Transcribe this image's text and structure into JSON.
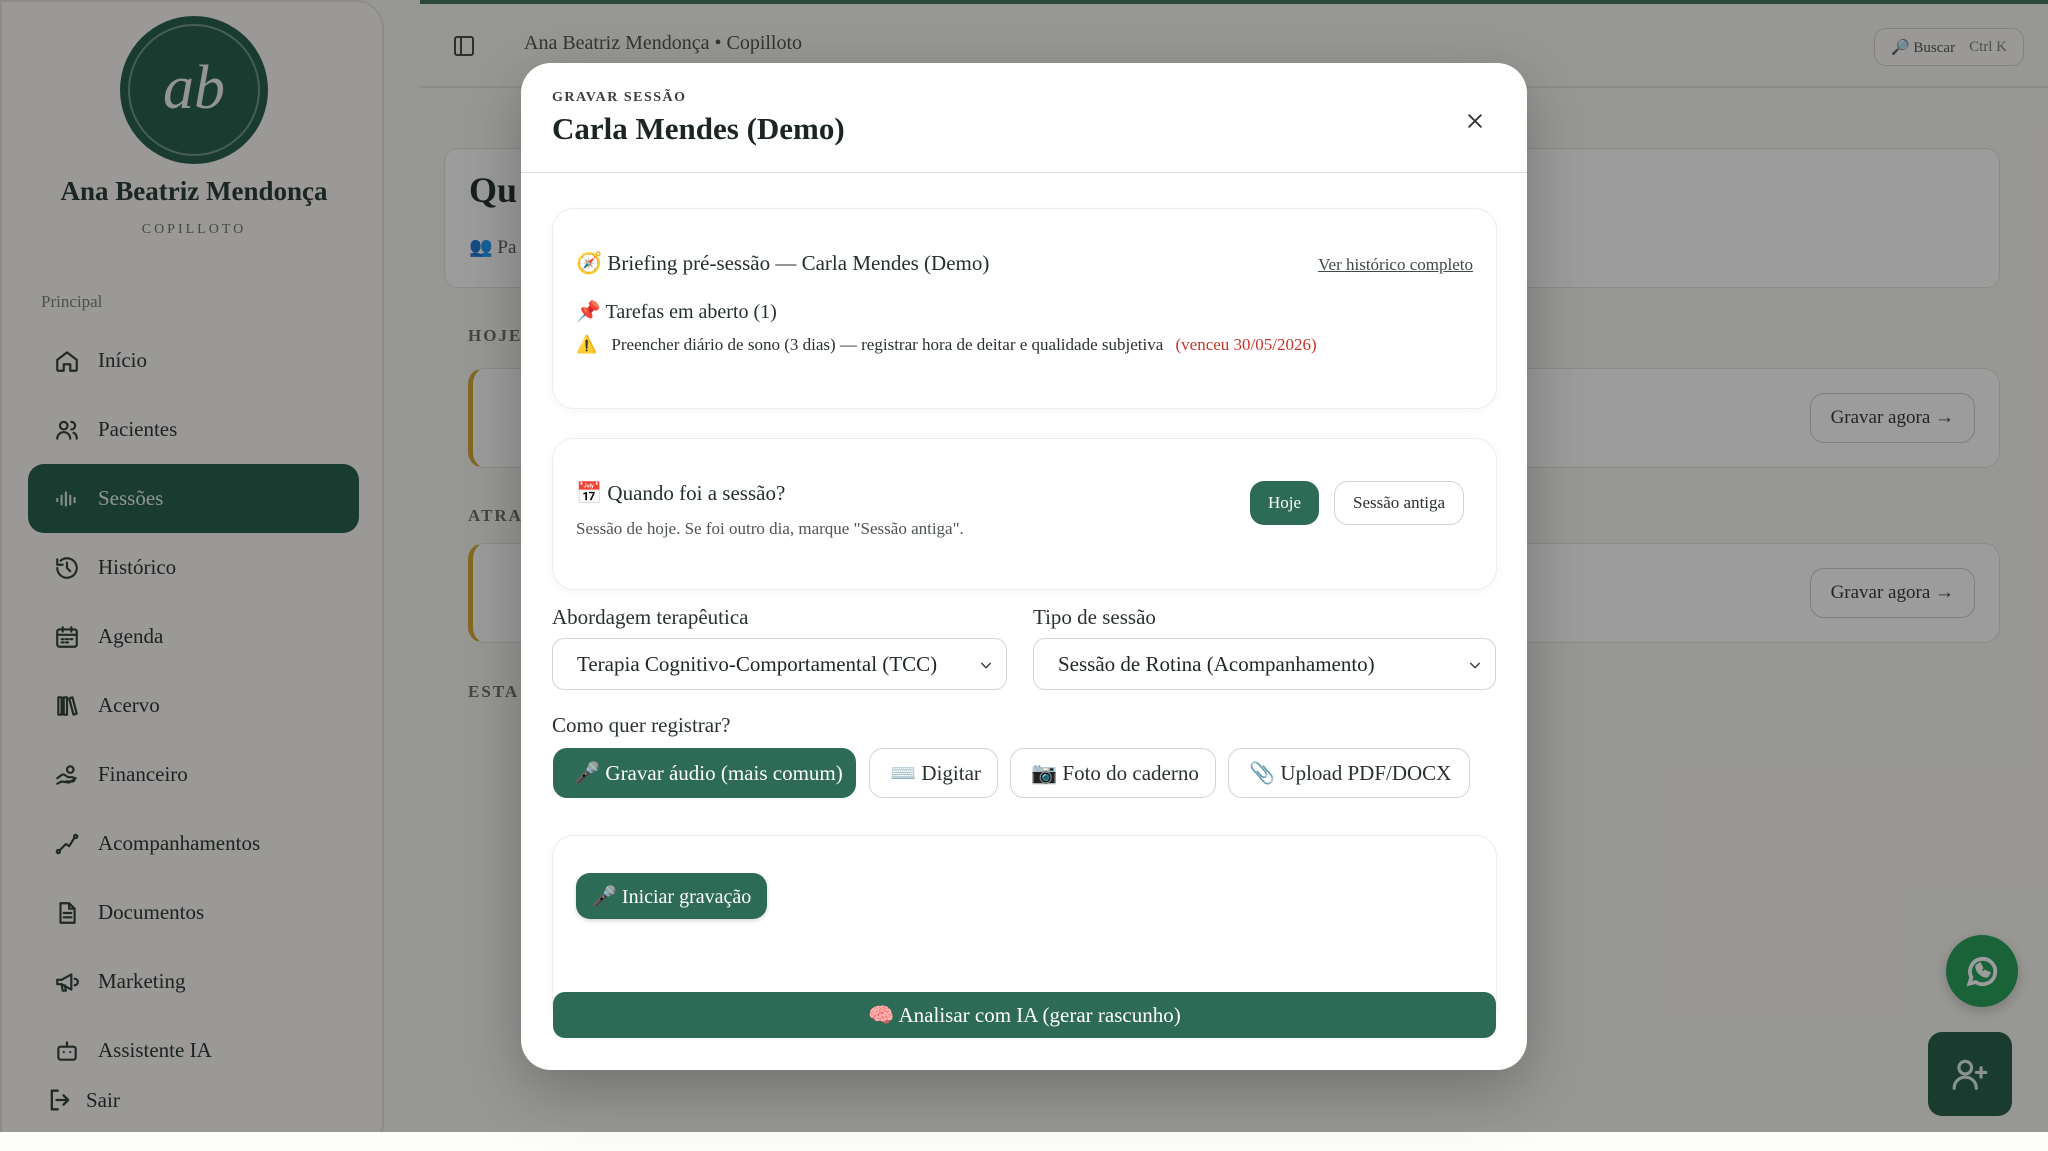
{
  "sidebar": {
    "avatar_initials": "ab",
    "user_name": "Ana Beatriz Mendonça",
    "user_role": "COPILLOTO",
    "section": "Principal",
    "items": [
      {
        "label": "Início",
        "icon": "home-icon"
      },
      {
        "label": "Pacientes",
        "icon": "users-icon"
      },
      {
        "label": "Sessões",
        "icon": "audio-wave-icon",
        "active": true
      },
      {
        "label": "Histórico",
        "icon": "history-icon"
      },
      {
        "label": "Agenda",
        "icon": "calendar-icon"
      },
      {
        "label": "Acervo",
        "icon": "library-icon"
      },
      {
        "label": "Financeiro",
        "icon": "hand-coins-icon"
      },
      {
        "label": "Acompanhamentos",
        "icon": "trend-line-icon"
      },
      {
        "label": "Documentos",
        "icon": "document-icon"
      },
      {
        "label": "Marketing",
        "icon": "megaphone-icon"
      },
      {
        "label": "Assistente IA",
        "icon": "bot-icon"
      }
    ],
    "logout": "Sair"
  },
  "topbar": {
    "breadcrumb": "Ana Beatriz Mendonça • Copilloto",
    "search_label": "🔎 Buscar",
    "search_shortcut": "Ctrl K"
  },
  "background": {
    "title_partial": "Qu",
    "subtitle_partial": "Pa",
    "sections": [
      "HOJE",
      "ATRA",
      "ESTA"
    ],
    "record_now": "Gravar agora →"
  },
  "modal": {
    "eyebrow": "GRAVAR SESSÃO",
    "title": "Carla Mendes (Demo)",
    "briefing": {
      "title": "🧭 Briefing pré-sessão — Carla Mendes (Demo)",
      "history_link": "Ver histórico completo",
      "tasks_title": "📌 Tarefas em aberto (1)",
      "task_icon": "⚠️",
      "task_text": "Preencher diário de sono (3 dias) — registrar hora de deitar e qualidade subjetiva",
      "task_due": "(venceu 30/05/2026)"
    },
    "when": {
      "title": "📅 Quando foi a sessão?",
      "subtitle": "Sessão de hoje. Se foi outro dia, marque \"Sessão antiga\".",
      "today": "Hoje",
      "old": "Sessão antiga"
    },
    "approach": {
      "label": "Abordagem terapêutica",
      "value": "Terapia Cognitivo-Comportamental (TCC)"
    },
    "session_type": {
      "label": "Tipo de sessão",
      "value": "Sessão de Rotina (Acompanhamento)"
    },
    "register": {
      "label": "Como quer registrar?",
      "options": [
        "🎤 Gravar áudio (mais comum)",
        "⌨️ Digitar",
        "📷 Foto do caderno",
        "📎 Upload PDF/DOCX"
      ]
    },
    "start_recording": "🎤 Iniciar gravação",
    "analyze": "🧠 Analisar com IA (gerar rascunho)"
  },
  "colors": {
    "brand_dark": "#1f5b45",
    "brand": "#2e6b56",
    "warning": "#c8342a",
    "accent_border": "#d3a72f",
    "whatsapp": "#1f9d55"
  }
}
